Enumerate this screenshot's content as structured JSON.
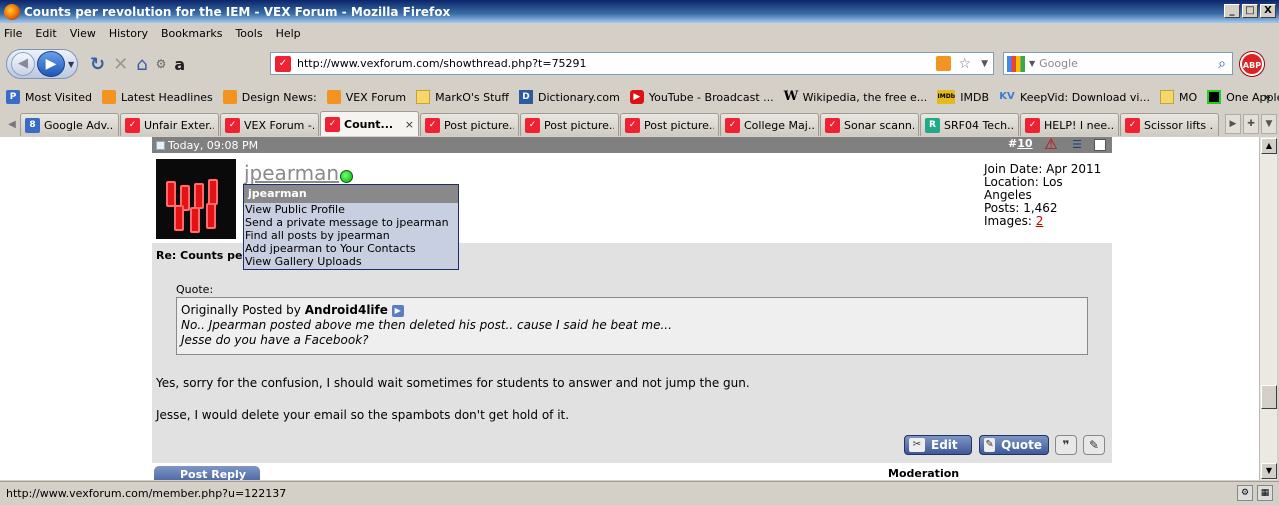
{
  "window": {
    "title": "Counts per revolution for the IEM - VEX Forum - Mozilla Firefox",
    "controls": [
      "_",
      "□",
      "X"
    ]
  },
  "menu": [
    "File",
    "Edit",
    "View",
    "History",
    "Bookmarks",
    "Tools",
    "Help"
  ],
  "nav": {
    "url": "http://www.vexforum.com/showthread.php?t=75291",
    "search_placeholder": "Google",
    "abp_label": "ABP"
  },
  "bookmarks": [
    {
      "label": "Most Visited",
      "icon": "most-visited"
    },
    {
      "label": "Latest Headlines",
      "icon": "rss"
    },
    {
      "label": "Design News:",
      "icon": "rss"
    },
    {
      "label": "VEX Forum",
      "icon": "rss"
    },
    {
      "label": "MarkO's Stuff",
      "icon": "folder"
    },
    {
      "label": "Dictionary.com",
      "icon": "dictionary"
    },
    {
      "label": "YouTube - Broadcast ...",
      "icon": "youtube"
    },
    {
      "label": "Wikipedia, the free e...",
      "icon": "wikipedia"
    },
    {
      "label": "IMDB",
      "icon": "imdb"
    },
    {
      "label": "KeepVid: Download vi...",
      "icon": "keepvid"
    },
    {
      "label": "MO",
      "icon": "folder"
    },
    {
      "label": "One Apple II Owner's...",
      "icon": "apple2"
    }
  ],
  "tabs": [
    {
      "label": "Google Adv...",
      "icon": "google"
    },
    {
      "label": "Unfair Exter...",
      "icon": "vex"
    },
    {
      "label": "VEX Forum -...",
      "icon": "vex"
    },
    {
      "label": "Count...",
      "icon": "vex",
      "active": true,
      "close": "×"
    },
    {
      "label": "Post picture...",
      "icon": "vex"
    },
    {
      "label": "Post picture...",
      "icon": "vex"
    },
    {
      "label": "Post picture...",
      "icon": "vex"
    },
    {
      "label": "College Maj...",
      "icon": "vex"
    },
    {
      "label": "Sonar scann...",
      "icon": "vex"
    },
    {
      "label": "SRF04 Tech...",
      "icon": "srf"
    },
    {
      "label": "HELP! I nee...",
      "icon": "vex"
    },
    {
      "label": "Scissor lifts ...",
      "icon": "vex"
    }
  ],
  "post": {
    "date": "Today, 09:08 PM",
    "number_prefix": "#",
    "number": "10",
    "username": "jpearman",
    "join_date": "Join Date: Apr 2011",
    "location": "Location: Los Angeles",
    "posts": "Posts: 1,462",
    "images_label": "Images:",
    "images_count": "2",
    "title": "Re: Counts per r",
    "quote_label": "Quote:",
    "quote_prefix": "Originally Posted by",
    "quote_author": "Android4life",
    "quote_line1": "No.. Jpearman posted above me then deleted his post.. cause I said he beat me...",
    "quote_line2": "Jesse do you have a Facebook?",
    "message_line1": "Yes, sorry for the confusion, I should wait sometimes for students to answer and not jump the gun.",
    "message_line2": "Jesse, I would delete your email so the spambots don't get hold of it.",
    "edit_label": "Edit",
    "quote_button_label": "Quote"
  },
  "user_menu": {
    "header": "jpearman",
    "items": [
      "View Public Profile",
      "Send a private message to jpearman",
      "Find all posts by jpearman",
      "Add jpearman to Your Contacts",
      "View Gallery Uploads"
    ]
  },
  "below_post": {
    "reply_label": "Post Reply",
    "moderation_label": "Moderation"
  },
  "status": {
    "text": "http://www.vexforum.com/member.php?u=122137"
  },
  "colors": {
    "titlebar": "#0a246a",
    "post_header": "#808080",
    "popup_bg": "#c7cfe0",
    "link_red": "#cc0000"
  }
}
